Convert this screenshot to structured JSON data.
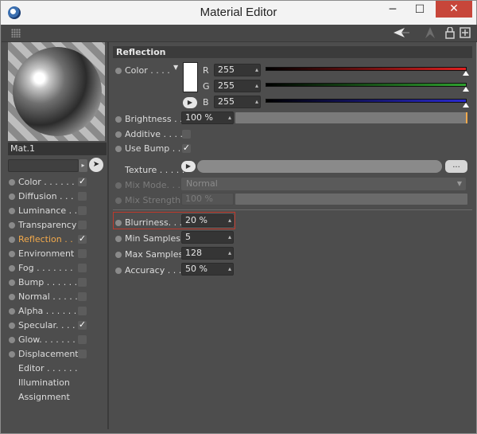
{
  "window": {
    "title": "Material Editor",
    "minimize": "─",
    "maximize": "☐",
    "close": "✕"
  },
  "toolbar": {
    "icons": [
      "arrow-back-icon",
      "arrow-forward-icon",
      "lock-icon",
      "new-window-icon"
    ]
  },
  "sidebar": {
    "material_name": "Mat.1",
    "channels": [
      {
        "label": "Color . . . . . .",
        "checked": true,
        "has_dot": true,
        "active": false
      },
      {
        "label": "Diffusion . . .",
        "checked": false,
        "has_dot": true,
        "active": false
      },
      {
        "label": "Luminance . . .",
        "checked": false,
        "has_dot": true,
        "active": false
      },
      {
        "label": "Transparency",
        "checked": false,
        "has_dot": true,
        "active": false
      },
      {
        "label": "Reflection . .",
        "checked": true,
        "has_dot": true,
        "active": true
      },
      {
        "label": "Environment",
        "checked": false,
        "has_dot": true,
        "active": false
      },
      {
        "label": "Fog . . . . . . .",
        "checked": false,
        "has_dot": true,
        "active": false
      },
      {
        "label": "Bump . . . . . .",
        "checked": false,
        "has_dot": true,
        "active": false
      },
      {
        "label": "Normal . . . . .",
        "checked": false,
        "has_dot": true,
        "active": false
      },
      {
        "label": "Alpha . . . . . .",
        "checked": false,
        "has_dot": true,
        "active": false
      },
      {
        "label": "Specular. . . .",
        "checked": true,
        "has_dot": true,
        "active": false
      },
      {
        "label": "Glow. . . . . . .",
        "checked": false,
        "has_dot": true,
        "active": false
      },
      {
        "label": "Displacement",
        "checked": false,
        "has_dot": true,
        "active": false
      },
      {
        "label": "Editor . . . . . .",
        "checked": null,
        "has_dot": false,
        "active": false
      },
      {
        "label": "Illumination",
        "checked": null,
        "has_dot": false,
        "active": false
      },
      {
        "label": "Assignment",
        "checked": null,
        "has_dot": false,
        "active": false
      }
    ]
  },
  "reflection": {
    "section_title": "Reflection",
    "color_label": "Color . . . .",
    "r_label": "R",
    "g_label": "G",
    "b_label": "B",
    "r_value": "255",
    "g_value": "255",
    "b_value": "255",
    "swatch_color": "#ffffff",
    "brightness_label": "Brightness . .",
    "brightness_value": "100 %",
    "additive_label": "Additive . . . .",
    "use_bump_label": "Use Bump . .",
    "use_bump_checkmark": "✓",
    "texture_label": "Texture . . . . .",
    "texture_button": "...",
    "mix_mode_label": "Mix Mode. . .",
    "mix_mode_value": "Normal",
    "mix_strength_label": "Mix Strength",
    "mix_strength_value": "100 %",
    "blurriness_label": "Blurriness. . .",
    "blurriness_value": "20 %",
    "min_samples_label": "Min Samples",
    "min_samples_value": "5",
    "max_samples_label": "Max Samples",
    "max_samples_value": "128",
    "accuracy_label": "Accuracy . . . .",
    "accuracy_value": "50 %"
  },
  "colors": {
    "accent": "#f2a94b",
    "highlight_border": "#c0392b",
    "red": "#e02020",
    "green": "#2ea02e",
    "blue": "#2a2ad0"
  }
}
